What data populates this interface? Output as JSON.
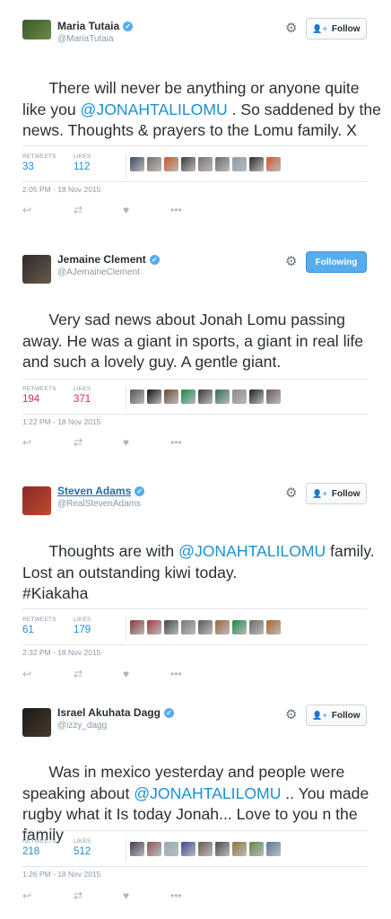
{
  "follow_label": "Follow",
  "following_label": "Following",
  "labels": {
    "retweets": "RETWEETS",
    "likes": "LIKES"
  },
  "tweets": [
    {
      "name": "Maria Tutaia",
      "handle": "@MariaTutaia",
      "text_before": "There will never be anything or anyone quite like you ",
      "mention": "@JONAHTALILOMU",
      "text_after": " . So saddened by the news. Thoughts & prayers to the Lomu family. X",
      "retweets": "33",
      "likes": "112",
      "time": "2:05 PM - 18 Nov 2015",
      "follow_state": "Follow",
      "liker_colors": [
        "#3a4a63",
        "#7a6f67",
        "#c9562a",
        "#3b3b3b",
        "#7b6e72",
        "#6b6b6b",
        "#8a9aa8",
        "#2a2a2a",
        "#d05a2c"
      ]
    },
    {
      "name": "Jemaine Clement",
      "handle": "@AJemaineClement",
      "text_before": "Very sad news about Jonah Lomu passing away. He was a giant in sports, a giant in real life and such a lovely guy. A gentle giant.",
      "mention": "",
      "text_after": "",
      "retweets": "194",
      "likes": "371",
      "time": "1:22 PM - 18 Nov 2015",
      "follow_state": "Following",
      "liker_colors": [
        "#555555",
        "#111111",
        "#6a4a3a",
        "#1a8a4a",
        "#3a3a3a",
        "#2f6f4f",
        "#8a8a8a",
        "#222222",
        "#6a5a5a"
      ]
    },
    {
      "name": "Steven Adams",
      "handle": "@RealStevenAdams",
      "text_before": "Thoughts are with ",
      "mention": "@JONAHTALILOMU",
      "text_after": " family.\nLost an outstanding kiwi today.\n#Kiakaha",
      "retweets": "61",
      "likes": "179",
      "time": "2:32 PM - 18 Nov 2015",
      "follow_state": "Follow",
      "liker_colors": [
        "#8a3a3a",
        "#a33b3b",
        "#444444",
        "#7a7a7a",
        "#5a5a5a",
        "#9a6a3a",
        "#1a8a4a",
        "#6a6a6a",
        "#b0642a"
      ]
    },
    {
      "name": "Israel Akuhata Dagg",
      "handle": "@izzy_dagg",
      "text_before": "Was in mexico yesterday and people were speaking about ",
      "mention": "@JONAHTALILOMU",
      "text_after": " .. You made rugby what it Is today Jonah... Love to you n the family",
      "retweets": "218",
      "likes": "512",
      "time": "1:26 PM - 18 Nov 2015",
      "follow_state": "Follow",
      "liker_colors": [
        "#4a3a5a",
        "#8a5a5a",
        "#9aaab8",
        "#3a4a9a",
        "#6a5a4a",
        "#4a4a4a",
        "#8a7a3a",
        "#5a8a4a",
        "#5a7a9a"
      ]
    }
  ]
}
